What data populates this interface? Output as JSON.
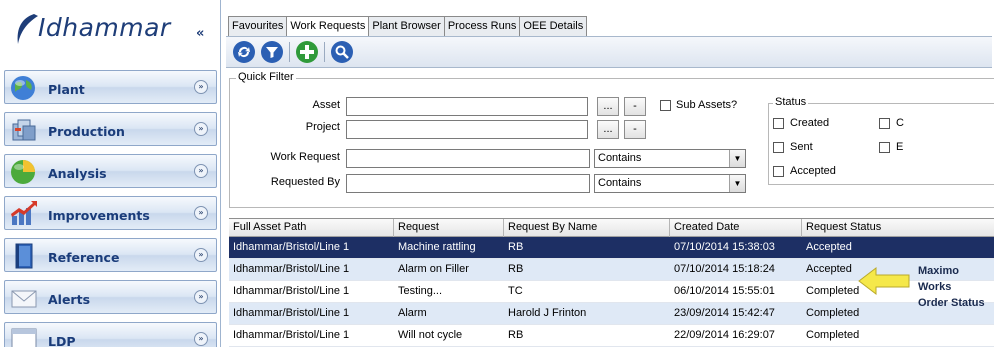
{
  "sidebar": {
    "logo_text": "Idhammar",
    "collapse_glyph": "«",
    "items": [
      {
        "label": "Plant",
        "icon": "globe-icon"
      },
      {
        "label": "Production",
        "icon": "production-icon"
      },
      {
        "label": "Analysis",
        "icon": "analysis-icon"
      },
      {
        "label": "Improvements",
        "icon": "chart-arrow-icon"
      },
      {
        "label": "Reference",
        "icon": "book-icon"
      },
      {
        "label": "Alerts",
        "icon": "envelope-icon"
      },
      {
        "label": "LDP",
        "icon": "window-icon"
      }
    ],
    "chevron_glyph": "»"
  },
  "tabs": [
    {
      "label": "Favourites",
      "active": false
    },
    {
      "label": "Work Requests",
      "active": true
    },
    {
      "label": "Plant Browser",
      "active": false
    },
    {
      "label": "Process Runs",
      "active": false
    },
    {
      "label": "OEE Details",
      "active": false
    }
  ],
  "toolbar": {
    "buttons": [
      "refresh-icon",
      "filter-icon",
      "add-icon",
      "search-icon"
    ]
  },
  "quick_filter": {
    "legend": "Quick Filter",
    "asset_label": "Asset",
    "asset_value": "",
    "project_label": "Project",
    "project_value": "",
    "work_request_label": "Work Request",
    "work_request_value": "",
    "work_request_mode": "Contains",
    "requested_by_label": "Requested By",
    "requested_by_value": "",
    "requested_by_mode": "Contains",
    "browse_label": "...",
    "clear_label": "-",
    "sub_assets_label": "Sub Assets?",
    "sub_assets_checked": false,
    "status": {
      "legend": "Status",
      "options": [
        {
          "label": "Created",
          "checked": false
        },
        {
          "label": "Sent",
          "checked": false
        },
        {
          "label": "Accepted",
          "checked": false
        },
        {
          "label": "C",
          "checked": false
        },
        {
          "label": "E",
          "checked": false
        }
      ]
    }
  },
  "grid": {
    "columns": [
      "Full Asset Path",
      "Request",
      "Request By Name",
      "Created Date",
      "Request Status"
    ],
    "rows": [
      {
        "asset_path": "Idhammar/Bristol/Line 1",
        "request": "Machine rattling",
        "request_by": "RB",
        "created": "07/10/2014 15:38:03",
        "status": "Accepted",
        "selected": true
      },
      {
        "asset_path": "Idhammar/Bristol/Line 1",
        "request": "Alarm on Filler",
        "request_by": "RB",
        "created": "07/10/2014 15:18:24",
        "status": "Accepted",
        "selected": false
      },
      {
        "asset_path": "Idhammar/Bristol/Line 1",
        "request": "Testing...",
        "request_by": "TC",
        "created": "06/10/2014 15:55:01",
        "status": "Completed",
        "selected": false
      },
      {
        "asset_path": "Idhammar/Bristol/Line 1",
        "request": "Alarm",
        "request_by": "Harold J Frinton",
        "created": "23/09/2014 15:42:47",
        "status": "Completed",
        "selected": false
      },
      {
        "asset_path": "Idhammar/Bristol/Line 1",
        "request": "Will not cycle",
        "request_by": "RB",
        "created": "22/09/2014 16:29:07",
        "status": "Completed",
        "selected": false
      }
    ]
  },
  "annotation": {
    "line1": "Maximo Works",
    "line2": "Order Status",
    "arrow_color": "#f5e84a"
  },
  "colors": {
    "brand_blue": "#1e3d78",
    "selected_row": "#1d2f64",
    "alt_row": "#dfe9f6"
  }
}
